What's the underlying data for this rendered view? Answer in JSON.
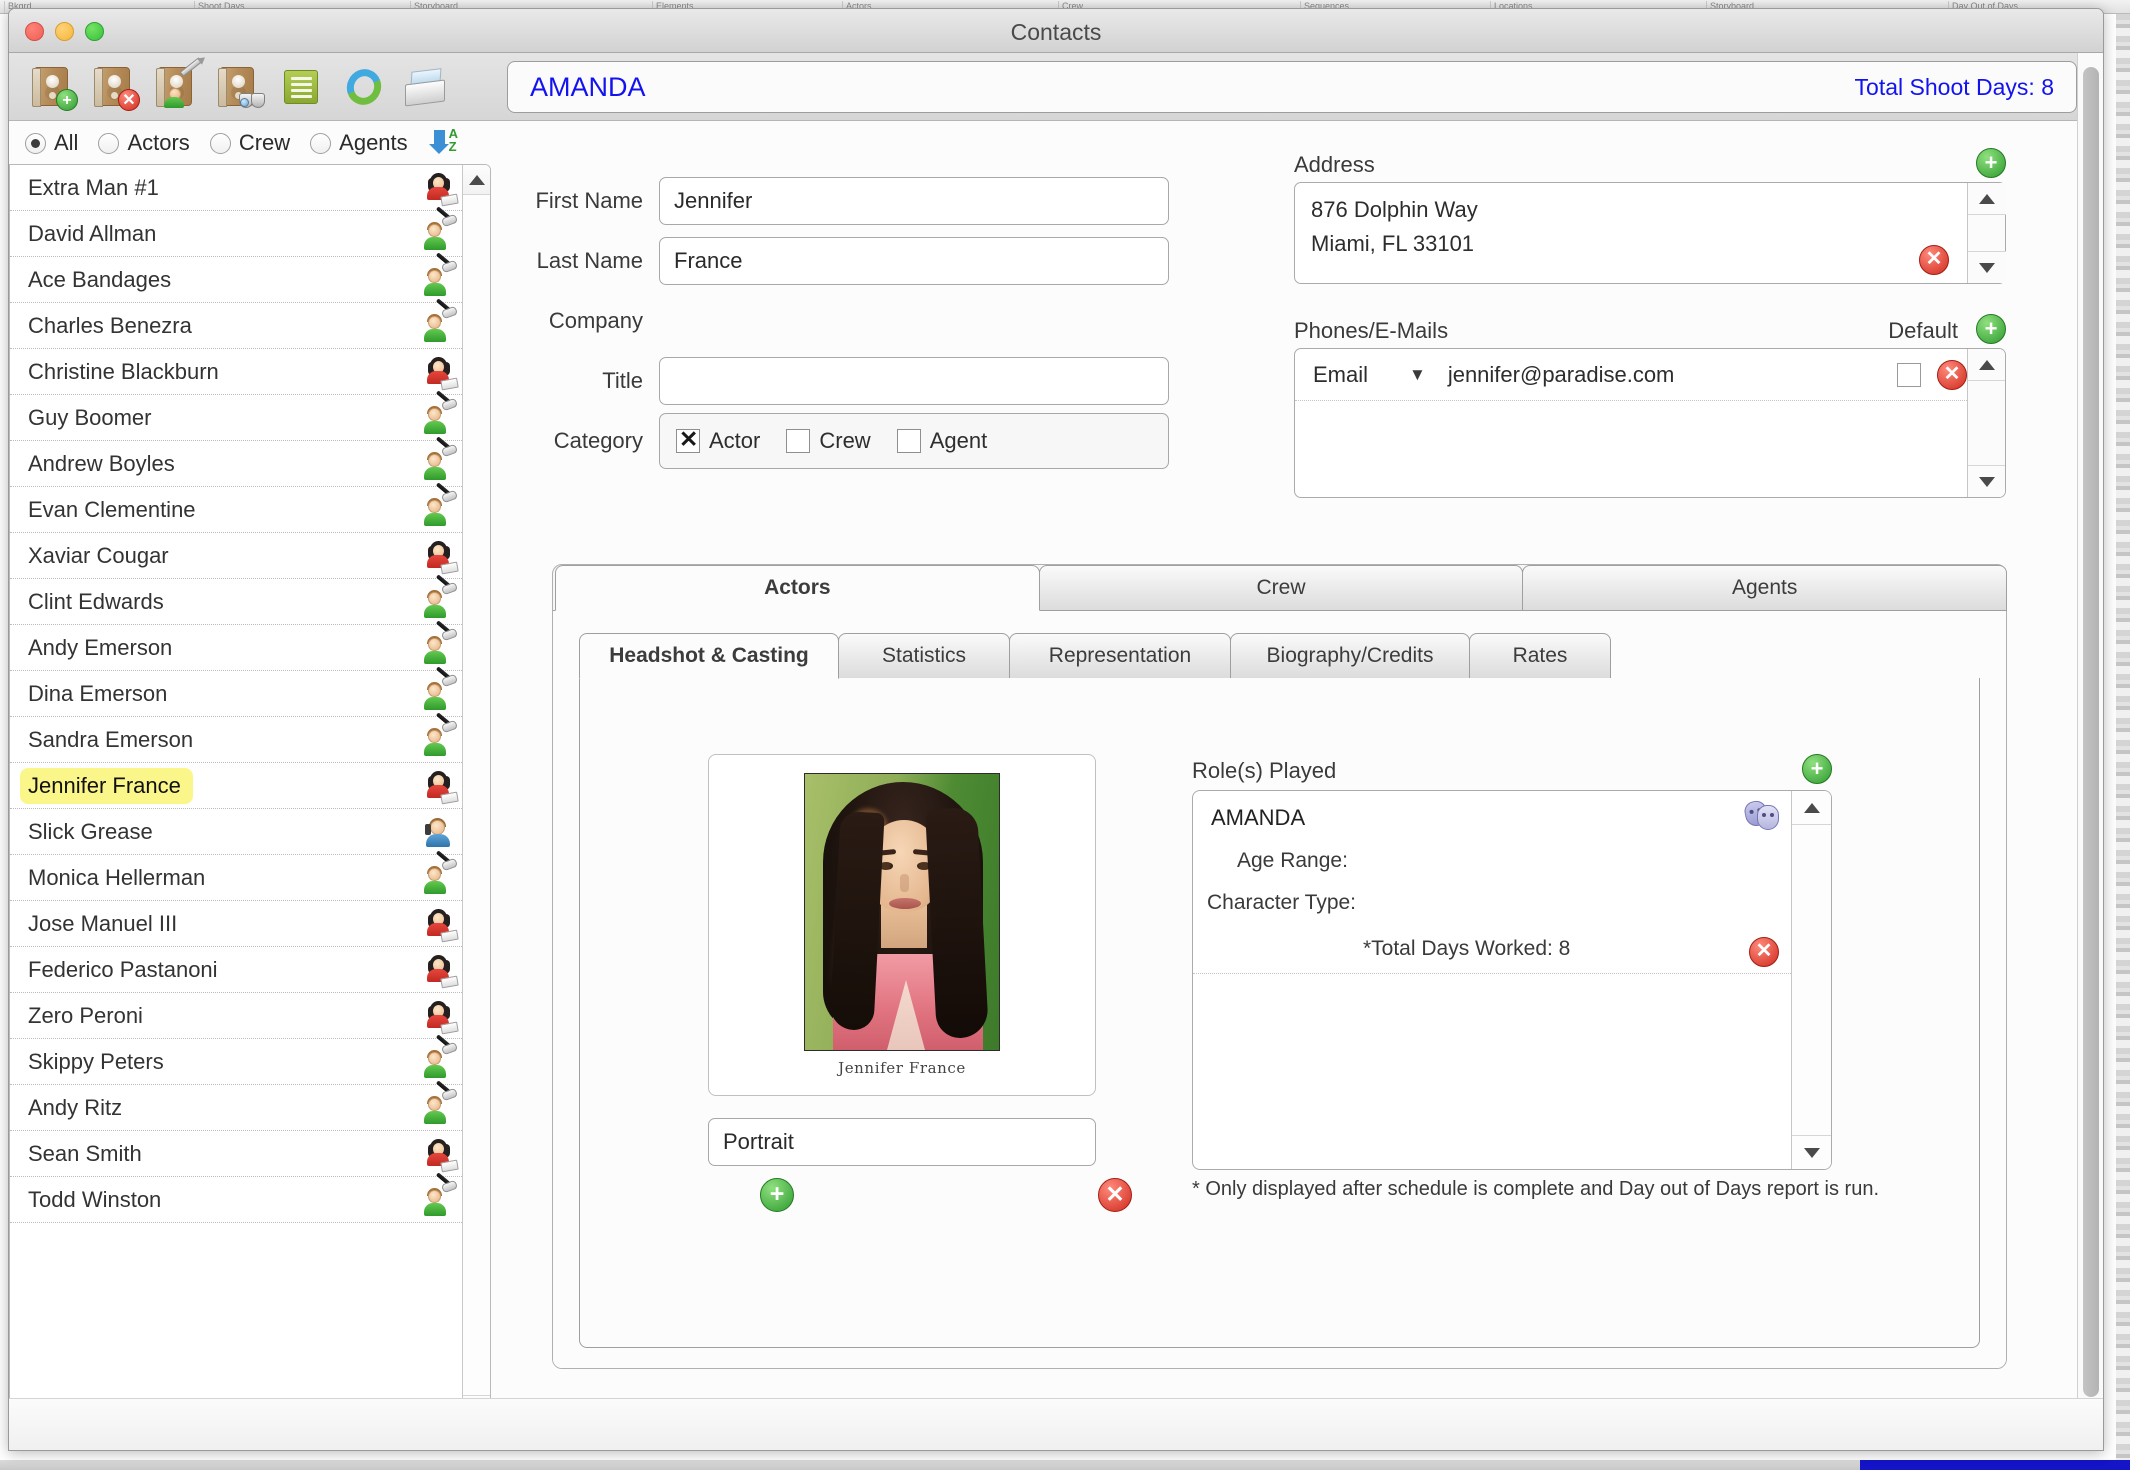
{
  "window": {
    "title": "Contacts",
    "traffic_lights": [
      "close",
      "minimize",
      "zoom"
    ]
  },
  "toolbar": {
    "buttons": [
      {
        "name": "add-contact",
        "icon": "address-book-add-icon",
        "label": "Add Contact"
      },
      {
        "name": "delete-contact",
        "icon": "address-book-delete-icon",
        "label": "Delete Contact"
      },
      {
        "name": "edit-contact",
        "icon": "address-book-edit-icon",
        "label": "Edit Contact"
      },
      {
        "name": "find-contact",
        "icon": "address-book-search-icon",
        "label": "Find Contact"
      },
      {
        "name": "list-view",
        "icon": "list-icon",
        "label": "List View"
      },
      {
        "name": "refresh",
        "icon": "refresh-icon",
        "label": "Refresh"
      },
      {
        "name": "print",
        "icon": "printer-icon",
        "label": "Print"
      }
    ]
  },
  "header": {
    "contact_name": "AMANDA",
    "shoot_days_label": "Total Shoot Days: 8"
  },
  "filters": {
    "options": [
      {
        "label": "All",
        "selected": true
      },
      {
        "label": "Actors",
        "selected": false
      },
      {
        "label": "Crew",
        "selected": false
      },
      {
        "label": "Agents",
        "selected": false
      }
    ],
    "sort_icon": "sort-az-icon"
  },
  "contact_list": {
    "items": [
      {
        "name": "Extra Man #1",
        "role": "actor",
        "selected": false
      },
      {
        "name": "David Allman",
        "role": "crew",
        "selected": false
      },
      {
        "name": "Ace Bandages",
        "role": "crew",
        "selected": false
      },
      {
        "name": "Charles Benezra",
        "role": "crew",
        "selected": false
      },
      {
        "name": "Christine Blackburn",
        "role": "actor",
        "selected": false
      },
      {
        "name": "Guy Boomer",
        "role": "crew",
        "selected": false
      },
      {
        "name": "Andrew Boyles",
        "role": "crew",
        "selected": false
      },
      {
        "name": "Evan Clementine",
        "role": "crew",
        "selected": false
      },
      {
        "name": "Xaviar Cougar",
        "role": "actor",
        "selected": false
      },
      {
        "name": "Clint Edwards",
        "role": "crew",
        "selected": false
      },
      {
        "name": "Andy Emerson",
        "role": "crew",
        "selected": false
      },
      {
        "name": "Dina Emerson",
        "role": "crew",
        "selected": false
      },
      {
        "name": "Sandra Emerson",
        "role": "crew",
        "selected": false
      },
      {
        "name": "Jennifer France",
        "role": "actor",
        "selected": true
      },
      {
        "name": "Slick Grease",
        "role": "agent",
        "selected": false
      },
      {
        "name": "Monica Hellerman",
        "role": "crew",
        "selected": false
      },
      {
        "name": "Jose Manuel III",
        "role": "actor",
        "selected": false
      },
      {
        "name": "Federico Pastanoni",
        "role": "actor",
        "selected": false
      },
      {
        "name": "Zero Peroni",
        "role": "actor",
        "selected": false
      },
      {
        "name": "Skippy Peters",
        "role": "crew",
        "selected": false
      },
      {
        "name": "Andy Ritz",
        "role": "crew",
        "selected": false
      },
      {
        "name": "Sean Smith",
        "role": "actor",
        "selected": false
      },
      {
        "name": "Todd Winston",
        "role": "crew",
        "selected": false
      }
    ]
  },
  "form": {
    "first_name_label": "First Name",
    "first_name_value": "Jennifer",
    "last_name_label": "Last Name",
    "last_name_value": "France",
    "company_label": "Company",
    "company_value": "",
    "title_label": "Title",
    "title_value": "",
    "category_label": "Category",
    "category": [
      {
        "label": "Actor",
        "checked": true
      },
      {
        "label": "Crew",
        "checked": false
      },
      {
        "label": "Agent",
        "checked": false
      }
    ]
  },
  "address": {
    "title": "Address",
    "add_icon": "plus-icon",
    "delete_icon": "delete-icon",
    "lines": "876 Dolphin Way\nMiami, FL 33101"
  },
  "phones": {
    "title": "Phones/E-Mails",
    "default_label": "Default",
    "add_icon": "plus-icon",
    "rows": [
      {
        "type": "Email",
        "value": "jennifer@paradise.com",
        "is_default": false
      }
    ]
  },
  "tabs_primary": [
    {
      "label": "Actors",
      "active": true
    },
    {
      "label": "Crew",
      "active": false
    },
    {
      "label": "Agents",
      "active": false
    }
  ],
  "tabs_secondary": [
    {
      "label": "Headshot & Casting",
      "active": true
    },
    {
      "label": "Statistics",
      "active": false
    },
    {
      "label": "Representation",
      "active": false
    },
    {
      "label": "Biography/Credits",
      "active": false
    },
    {
      "label": "Rates",
      "active": false
    }
  ],
  "headshot": {
    "caption": "Jennifer France",
    "portrait_value": "Portrait",
    "add_icon": "plus-icon",
    "delete_icon": "delete-icon"
  },
  "roles": {
    "title": "Role(s) Played",
    "add_icon": "plus-icon",
    "masks_icon": "theatre-masks-icon",
    "delete_icon": "delete-icon",
    "entry": {
      "name": "AMANDA",
      "age_range_label": "Age Range:",
      "age_range_value": "",
      "character_type_label": "Character Type:",
      "character_type_value": "",
      "total_days_label": "*Total Days Worked: 8"
    }
  },
  "footnote": "* Only displayed after schedule is complete and Day out of Days report is run.",
  "colors": {
    "accent_blue": "#1313f0",
    "selection_yellow": "#fbf68a",
    "green_add": "#2f9b2f",
    "red_delete": "#cf2b1e"
  },
  "background_apps": [
    "Bkgrd",
    "Shoot Days",
    "Storyboard",
    "Elements",
    "Actors",
    "Crew",
    "Sequences",
    "Locations",
    "Storyboard",
    "Day Out of Days"
  ]
}
